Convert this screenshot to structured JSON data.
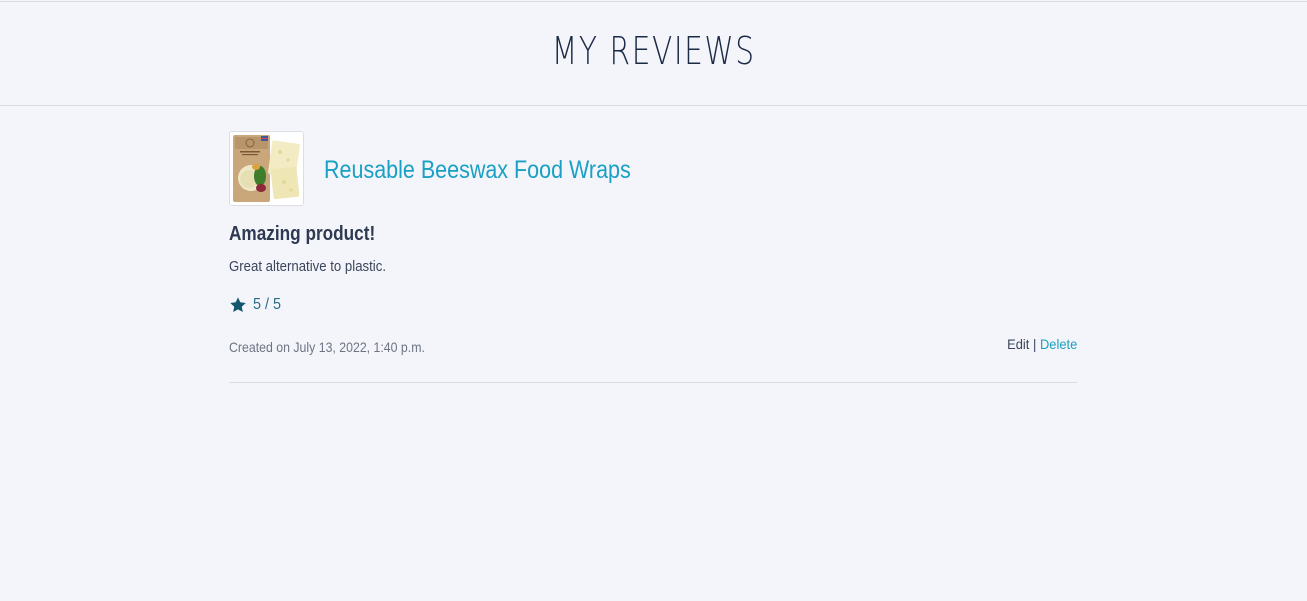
{
  "header": {
    "title": "MY REVIEWS"
  },
  "reviews": [
    {
      "product_name": "Reusable Beeswax Food Wraps",
      "thumbnail_alt": "Reusable Beeswax Food Wraps",
      "title": "Amazing product!",
      "body": "Great alternative to plastic.",
      "rating_text": "5 / 5",
      "rating_value": 5,
      "rating_max": 5,
      "created": "Created on July 13, 2022, 1:40 p.m.",
      "edit_label": "Edit",
      "separator": "|",
      "delete_label": "Delete"
    }
  ],
  "icons": {
    "rating": "star-icon"
  },
  "colors": {
    "background": "#f4f5fa",
    "title": "#1b2a47",
    "link_accent": "#1aa0c4",
    "star": "#13576e",
    "divider": "#dcdee4"
  }
}
